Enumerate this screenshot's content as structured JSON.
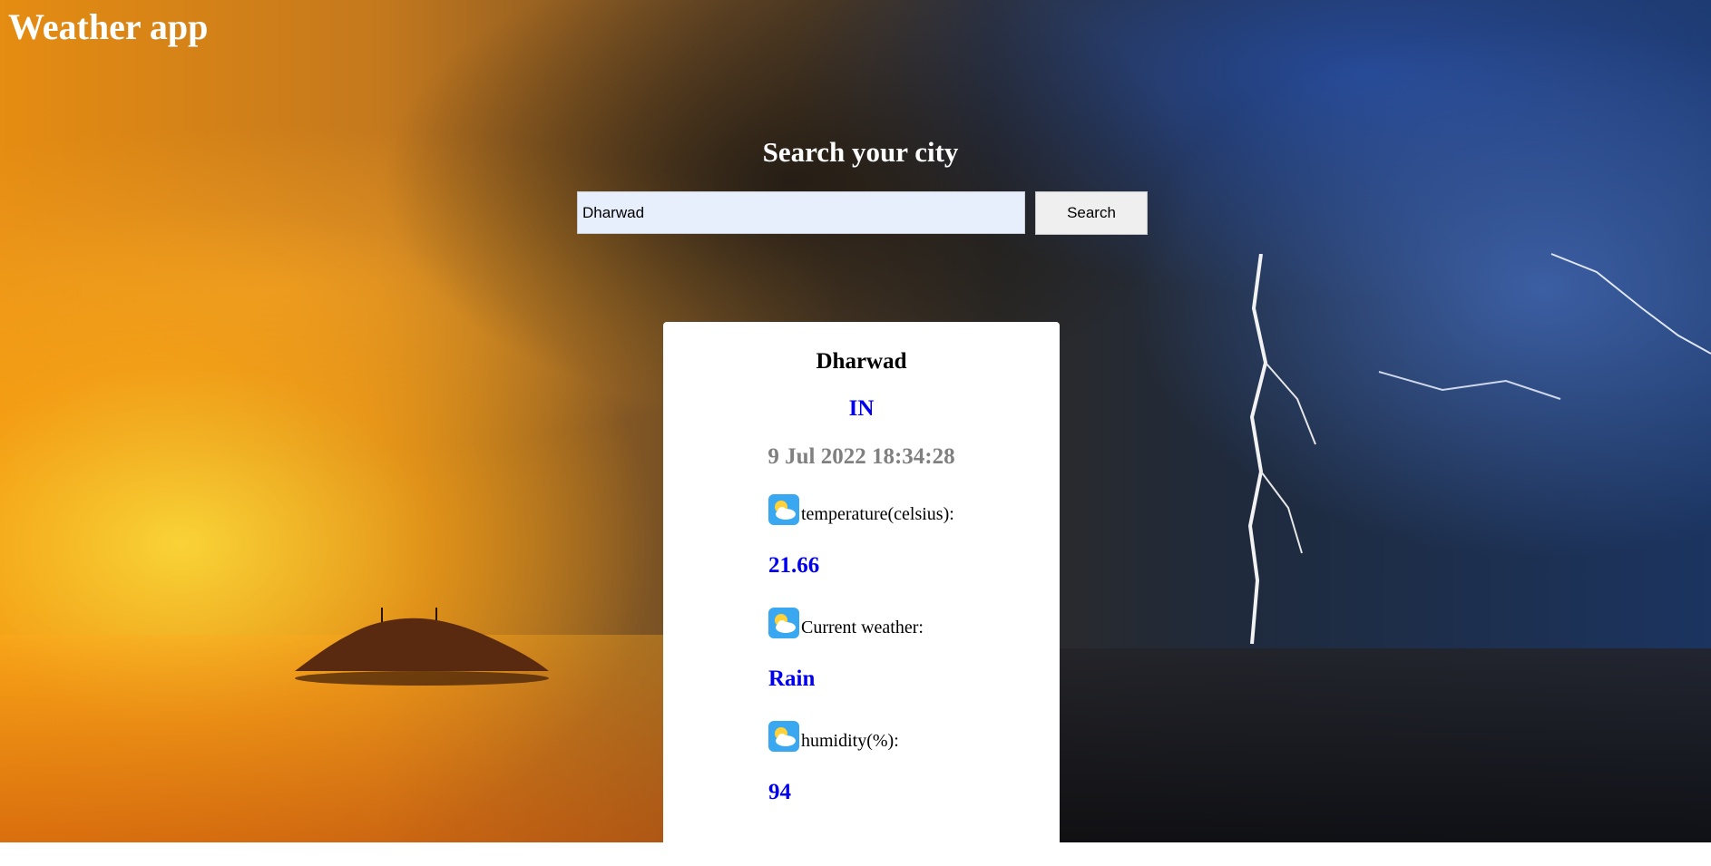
{
  "app": {
    "title": "Weather app"
  },
  "search": {
    "heading": "Search your city",
    "input_value": "Dharwad",
    "button_label": "Search"
  },
  "result": {
    "city": "Dharwad",
    "country": "IN",
    "datetime": "9 Jul 2022 18:34:28",
    "temperature_label": "temperature(celsius):",
    "temperature_value": "21.66",
    "weather_label": "Current weather:",
    "weather_value": "Rain",
    "humidity_label": "humidity(%):",
    "humidity_value": "94",
    "icon": "partly-cloudy-icon"
  },
  "colors": {
    "accent": "#0000ee",
    "date_gray": "#808080",
    "input_bg": "#e8effc"
  }
}
